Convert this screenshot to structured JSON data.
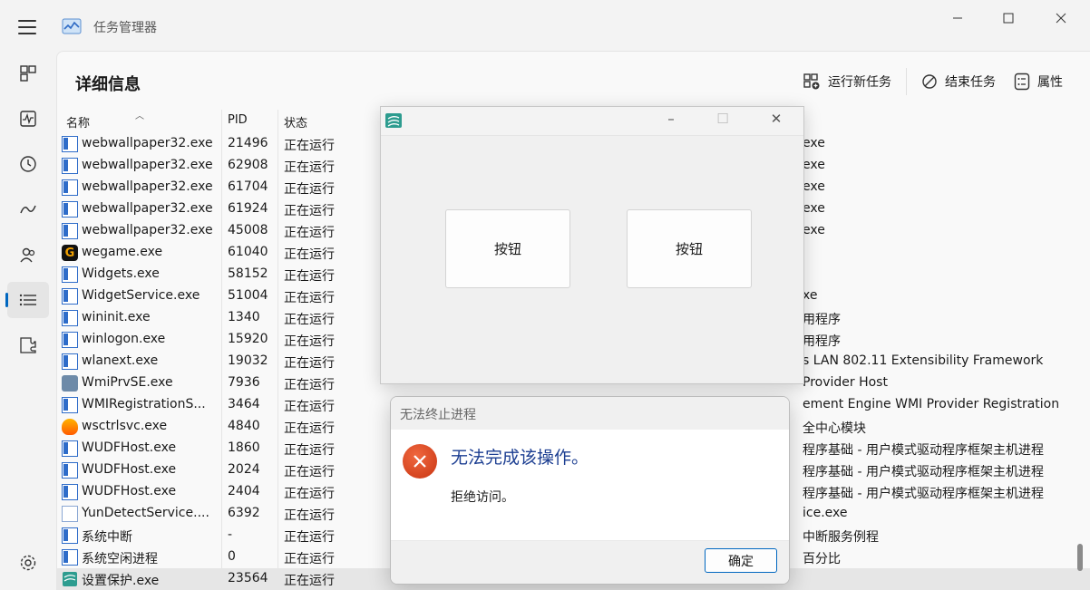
{
  "window": {
    "title": "任务管理器"
  },
  "page": {
    "title": "详细信息"
  },
  "toolbar": {
    "run_new_task": "运行新任务",
    "end_task": "结束任务",
    "properties": "属性"
  },
  "columns": {
    "name": "名称",
    "pid": "PID",
    "status": "状态"
  },
  "rows": [
    {
      "name": "webwallpaper32.exe",
      "pid": "21496",
      "status": "正在运行",
      "desc": "exe",
      "icon": "win"
    },
    {
      "name": "webwallpaper32.exe",
      "pid": "62908",
      "status": "正在运行",
      "desc": "exe",
      "icon": "win"
    },
    {
      "name": "webwallpaper32.exe",
      "pid": "61704",
      "status": "正在运行",
      "desc": "exe",
      "icon": "win"
    },
    {
      "name": "webwallpaper32.exe",
      "pid": "61924",
      "status": "正在运行",
      "desc": "exe",
      "icon": "win"
    },
    {
      "name": "webwallpaper32.exe",
      "pid": "45008",
      "status": "正在运行",
      "desc": "exe",
      "icon": "win"
    },
    {
      "name": "wegame.exe",
      "pid": "61040",
      "status": "正在运行",
      "desc": "",
      "icon": "wegame"
    },
    {
      "name": "Widgets.exe",
      "pid": "58152",
      "status": "正在运行",
      "desc": "",
      "icon": "win"
    },
    {
      "name": "WidgetService.exe",
      "pid": "51004",
      "status": "正在运行",
      "desc": "xe",
      "icon": "win"
    },
    {
      "name": "wininit.exe",
      "pid": "1340",
      "status": "正在运行",
      "desc": "用程序",
      "icon": "win"
    },
    {
      "name": "winlogon.exe",
      "pid": "15920",
      "status": "正在运行",
      "desc": "用程序",
      "icon": "win"
    },
    {
      "name": "wlanext.exe",
      "pid": "19032",
      "status": "正在运行",
      "desc": "s LAN 802.11 Extensibility Framework",
      "icon": "win"
    },
    {
      "name": "WmiPrvSE.exe",
      "pid": "7936",
      "status": "正在运行",
      "desc": "Provider Host",
      "icon": "gear"
    },
    {
      "name": "WMIRegistrationS...",
      "pid": "3464",
      "status": "正在运行",
      "desc": "ement Engine WMI Provider Registration",
      "icon": "win"
    },
    {
      "name": "wsctrlsvc.exe",
      "pid": "4840",
      "status": "正在运行",
      "desc": "全中心模块",
      "icon": "shield"
    },
    {
      "name": "WUDFHost.exe",
      "pid": "1860",
      "status": "正在运行",
      "desc": "程序基础 - 用户模式驱动程序框架主机进程",
      "icon": "win"
    },
    {
      "name": "WUDFHost.exe",
      "pid": "2024",
      "status": "正在运行",
      "desc": "程序基础 - 用户模式驱动程序框架主机进程",
      "icon": "win"
    },
    {
      "name": "WUDFHost.exe",
      "pid": "2404",
      "status": "正在运行",
      "desc": "程序基础 - 用户模式驱动程序框架主机进程",
      "icon": "win"
    },
    {
      "name": "YunDetectService....",
      "pid": "6392",
      "status": "正在运行",
      "desc": "ice.exe",
      "icon": "doc"
    },
    {
      "name": "系统中断",
      "pid": "-",
      "status": "正在运行",
      "desc": "中断服务例程",
      "icon": "win"
    },
    {
      "name": "系统空闲进程",
      "pid": "0",
      "status": "正在运行",
      "desc": "百分比",
      "icon": "win"
    },
    {
      "name": "设置保护.exe",
      "pid": "23564",
      "status": "正在运行",
      "desc": "",
      "icon": "app"
    }
  ],
  "app_window": {
    "button1": "按钮",
    "button2": "按钮"
  },
  "dialog": {
    "title": "无法终止进程",
    "main": "无法完成该操作。",
    "sub": "拒绝访问。",
    "ok": "确定"
  }
}
